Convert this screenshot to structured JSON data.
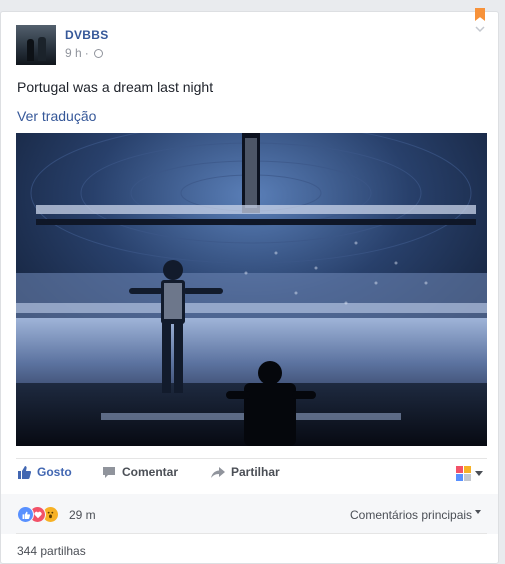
{
  "post": {
    "author": "DVBBS",
    "time": "9 h",
    "separator": "·",
    "privacy_icon": "globe-icon",
    "text": "Portugal was a dream last night",
    "translate_link": "Ver tradução",
    "bookmark_color": "#f7923a"
  },
  "actions": {
    "like": "Gosto",
    "comment": "Comentar",
    "share": "Partilhar"
  },
  "summary": {
    "reactions": [
      "like",
      "love",
      "wow"
    ],
    "reaction_count": "29 m",
    "comments_sort": "Comentários principais",
    "shares": "344 partilhas"
  },
  "colors": {
    "link_blue": "#365899",
    "like_blue": "#4267b2",
    "text": "#1d2129",
    "muted": "#90949c",
    "love_red": "#f25268",
    "wow_yellow": "#f7b125"
  }
}
